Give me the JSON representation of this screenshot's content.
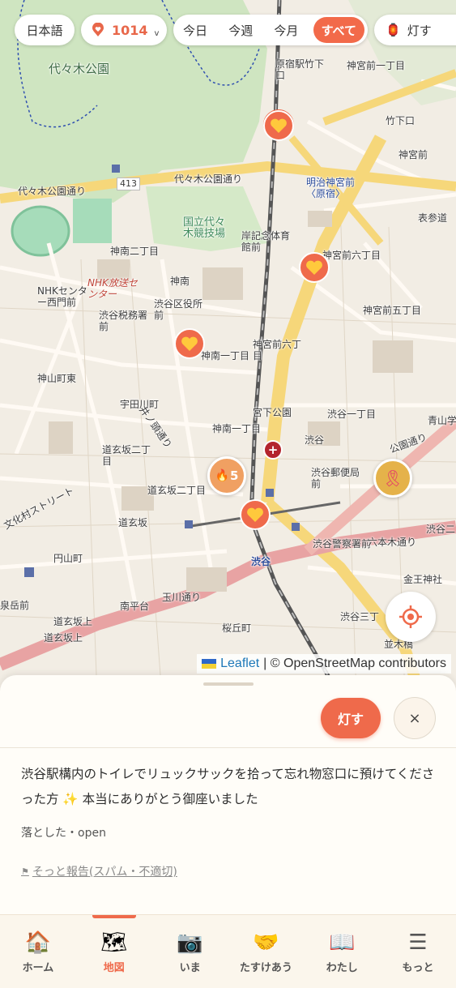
{
  "filters": {
    "language": "日本語",
    "count": "1014",
    "count_chevron": "v",
    "periods": [
      "今日",
      "今週",
      "今月",
      "すべて"
    ],
    "active_period": "すべて",
    "light_label": "灯す"
  },
  "map": {
    "labels": {
      "yoyogi_park": "代々木公園",
      "harajuku_station": "原宿駅竹下口",
      "jingumae_1": "神宮前一丁目",
      "takeshita": "竹下口",
      "jingumae_sando": "神宮前",
      "yoyogi_koen_dori_1": "代々木公園通り",
      "yoyogi_koen_dori_2": "代々木公園通り",
      "route_413": "413",
      "meiji_jingu": "明治神宮前〈原宿〉",
      "omotesando": "表参道",
      "stadium": "国立代々木競技場",
      "kishi_kinen": "岸記念体育館前",
      "jinnan_2": "神南二丁目",
      "jingumae_6": "神宮前六丁目",
      "nhk_center": "NHKセンター西門前",
      "nhk_hoso": "NHK放送センター",
      "jinnan": "神南",
      "shibuya_kuyakusho": "渋谷区役所前",
      "shibuya_zeimusho": "渋谷税務署前",
      "jingumae_5": "神宮前五丁目",
      "jinnan_1": "神南一丁目",
      "jingumae_6b": "神宮前六丁目",
      "kamiyamacho": "神山町東",
      "udagawacho": "宇田川町",
      "miyashita": "宮下公園",
      "shibuya_1": "渋谷一丁目",
      "dogenzaka_2": "道玄坂二丁目",
      "jinnan_1b": "神南一丁目",
      "shibuya": "渋谷",
      "shibuya_post": "渋谷郵便局前",
      "dogenzaka_2b": "道玄坂二丁目",
      "dogenzaka": "道玄坂",
      "maruyamacho": "円山町",
      "shibuya_station": "渋谷",
      "shibuya_police": "渋谷警察署前",
      "rokuhongi": "六本木通り",
      "konno": "金王神社",
      "nanpeidai": "南平台",
      "tamagawa": "玉川通り",
      "dogenzaka_ue": "道玄坂上",
      "dogenzaka_ue2": "道玄坂上",
      "sakuragaoka": "桜丘町",
      "shibuya_3": "渋谷三丁",
      "namiki": "並木橋",
      "aoyama": "青山学",
      "shibuya_2": "渋谷二",
      "sengoku": "泉岳前",
      "bunka": "文化村ストリート",
      "inokashira": "井ノ頭通り",
      "koen_dori": "公園通り",
      "cluster_count": "5"
    },
    "attribution_leaflet": "Leaflet",
    "attribution_osm": "| © OpenStreetMap contributors",
    "colors": {
      "accent": "#ef6a4b",
      "marker": "#ef6a4b",
      "cluster": "#f0a062",
      "ribbon": "#e5b24a",
      "rail_road": "#e8a3a3",
      "yellow_road": "#f6d77a"
    }
  },
  "sheet": {
    "light_button": "灯す",
    "close_button": "×",
    "post_text": "渋谷駅構内のトイレでリュックサックを拾って忘れ物窓口に預けてくださった方 ✨ 本当にありがとう御座いました",
    "meta": "落とした・open",
    "report": "そっと報告(スパム・不適切)"
  },
  "nav": [
    {
      "label": "ホーム",
      "icon": "house-icon",
      "glyph": "🏠"
    },
    {
      "label": "地図",
      "icon": "world-map-icon",
      "glyph": "🗺"
    },
    {
      "label": "いま",
      "icon": "camera-icon",
      "glyph": "📷"
    },
    {
      "label": "たすけあう",
      "icon": "handshake-icon",
      "glyph": "🤝"
    },
    {
      "label": "わたし",
      "icon": "book-icon",
      "glyph": "📖"
    },
    {
      "label": "もっと",
      "icon": "menu-icon",
      "glyph": "☰"
    }
  ],
  "nav_active": "地図"
}
